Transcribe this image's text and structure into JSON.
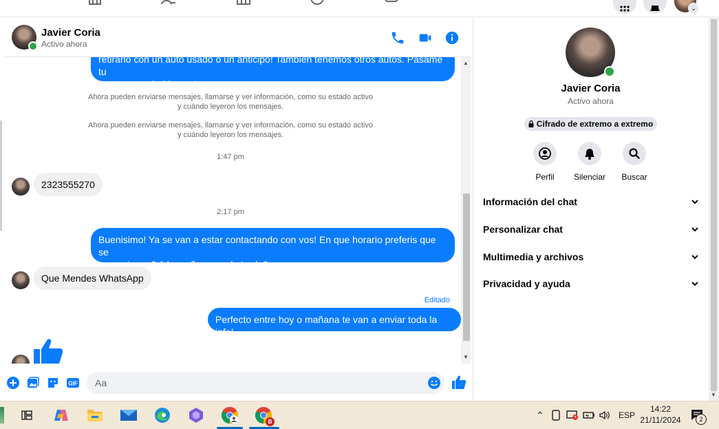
{
  "contact": {
    "name": "Javier Coria",
    "status": "Activo ahora"
  },
  "messages": {
    "out_1_line1": "retirarlo con un auto usado o un anticipo! Tambien tenemos otros autos. Pasame tu",
    "out_1_line2": "numero y te hablamos!",
    "system_1_line1": "Ahora pueden enviarse mensajes, llamarse y ver información, como su estado activo",
    "system_1_line2": "y cuándo leyeron los mensajes.",
    "system_2_line1": "Ahora pueden enviarse mensajes, llamarse y ver información, como su estado activo",
    "system_2_line2": "y cuándo leyeron los mensajes.",
    "time_1": "1:47 pm",
    "in_1": "2323555270",
    "time_2": "2:17 pm",
    "out_2_line1": "Buenisimo! Ya se van a estar contactando con vos! En que horario preferis que se",
    "out_2_line2": "comuniquen? A la mañana o a la tarde?",
    "in_2": "Que Mendes WhatsApp",
    "edited_label": "Editado",
    "out_3": "Perfecto entre hoy o mañana te van a enviar toda la info!"
  },
  "composer": {
    "placeholder": "Aa"
  },
  "info_panel": {
    "name": "Javier Coria",
    "status": "Activo ahora",
    "encryption": "Cifrado de extremo a extremo",
    "actions": [
      {
        "label": "Perfil"
      },
      {
        "label": "Silenciar"
      },
      {
        "label": "Buscar"
      }
    ],
    "sections": [
      {
        "label": "Información del chat"
      },
      {
        "label": "Personalizar chat"
      },
      {
        "label": "Multimedia y archivos"
      },
      {
        "label": "Privacidad y ayuda"
      }
    ]
  },
  "taskbar": {
    "language": "ESP",
    "time": "14:22",
    "date": "21/11/2024",
    "notifications": "2",
    "chrome_profile_badge": "B"
  },
  "colors": {
    "messenger_blue": "#0a7cff",
    "online_green": "#31a24c",
    "incoming_bubble": "#f0f0f0",
    "taskbar_bg": "#f2e8d8"
  }
}
